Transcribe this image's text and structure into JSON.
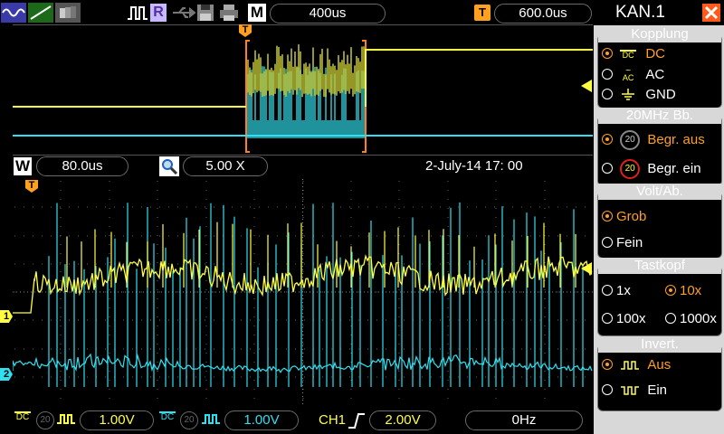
{
  "topbar": {
    "mode_badge": "M",
    "timebase": "400us",
    "trigger_badge": "T",
    "trigger_delay": "600.0us",
    "run_badge": "R"
  },
  "zoombar": {
    "window_badge": "W",
    "window_timebase": "80.0us",
    "zoom_factor": "5.00  X",
    "datetime": "2-July-14   17: 00"
  },
  "markers": {
    "trigger_marker": "T",
    "ch1_marker": "1",
    "ch2_marker": "2"
  },
  "sidepanel": {
    "title": "KAN.1",
    "coupling": {
      "header": "Kopplung",
      "options": [
        {
          "label": "DC",
          "icon_text": "DC",
          "selected": true
        },
        {
          "label": "AC",
          "icon_text": "AC",
          "selected": false
        },
        {
          "label": "GND",
          "selected": false
        }
      ]
    },
    "bandwidth": {
      "header": "20MHz  Bb.",
      "icon_text": "20",
      "options": [
        {
          "label": "Begr.  aus",
          "selected": true
        },
        {
          "label": "Begr.  ein",
          "selected": false
        }
      ]
    },
    "volts": {
      "header": "Volt/Ab.",
      "options": [
        {
          "label": "Grob",
          "selected": true
        },
        {
          "label": "Fein",
          "selected": false
        }
      ]
    },
    "probe": {
      "header": "Tastkopf",
      "options": [
        {
          "label": "1x",
          "selected": false
        },
        {
          "label": "10x",
          "selected": true
        },
        {
          "label": "100x",
          "selected": false
        },
        {
          "label": "1000x",
          "selected": false
        }
      ]
    },
    "invert": {
      "header": "Invert.",
      "options": [
        {
          "label": "Aus",
          "selected": true
        },
        {
          "label": "Ein",
          "selected": false
        }
      ]
    }
  },
  "bottombar": {
    "ch1_coupling": "DC",
    "ch1_bw": "20",
    "ch1_scale": "1.00V",
    "ch2_coupling": "DC",
    "ch2_bw": "20",
    "ch2_scale": "1.00V",
    "trigger_source": "CH1",
    "trigger_level": "2.00V",
    "frequency": "0Hz"
  },
  "colors": {
    "ch1": "#ffff40",
    "ch2": "#30e0f0",
    "accent": "#ffa020",
    "close": "#ff5a1a"
  }
}
